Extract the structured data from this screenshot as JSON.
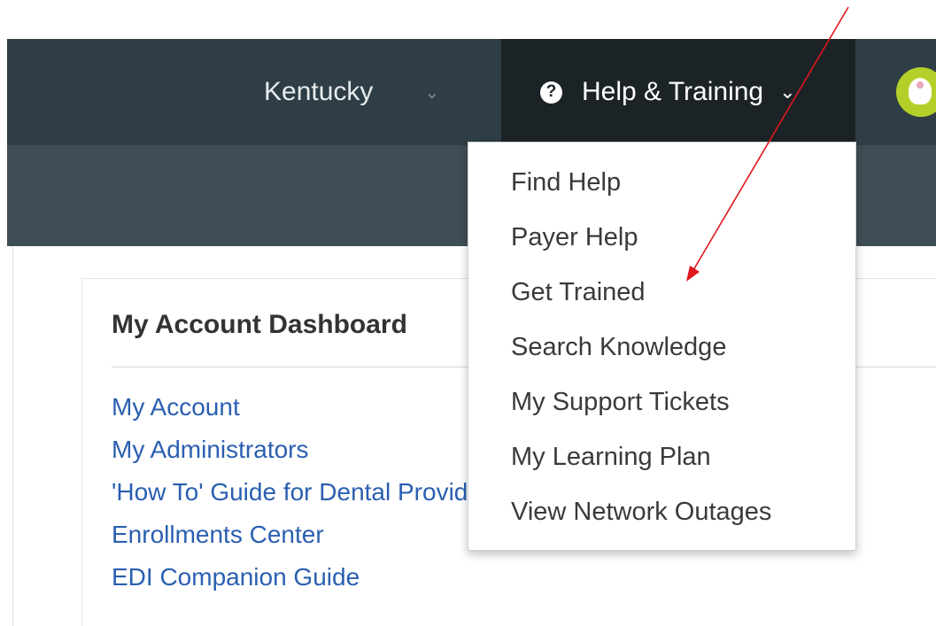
{
  "topnav": {
    "state_label": "Kentucky",
    "help_label": "Help & Training",
    "help_icon": "question-circle-icon",
    "chevron_icon": "chevron-down-icon"
  },
  "dropdown": {
    "items": [
      "Find Help",
      "Payer Help",
      "Get Trained",
      "Search Knowledge",
      "My Support Tickets",
      "My Learning Plan",
      "View Network Outages"
    ]
  },
  "dashboard": {
    "title": "My Account Dashboard",
    "links": [
      "My Account",
      "My Administrators",
      "'How To' Guide for Dental Providers",
      "Enrollments Center",
      "EDI Companion Guide"
    ]
  },
  "colors": {
    "topbar": "#2f3e46",
    "subbar": "#3f4d55",
    "help_active": "#1c2327",
    "link": "#2a5fb0",
    "annotation_arrow": "#e0161d"
  }
}
